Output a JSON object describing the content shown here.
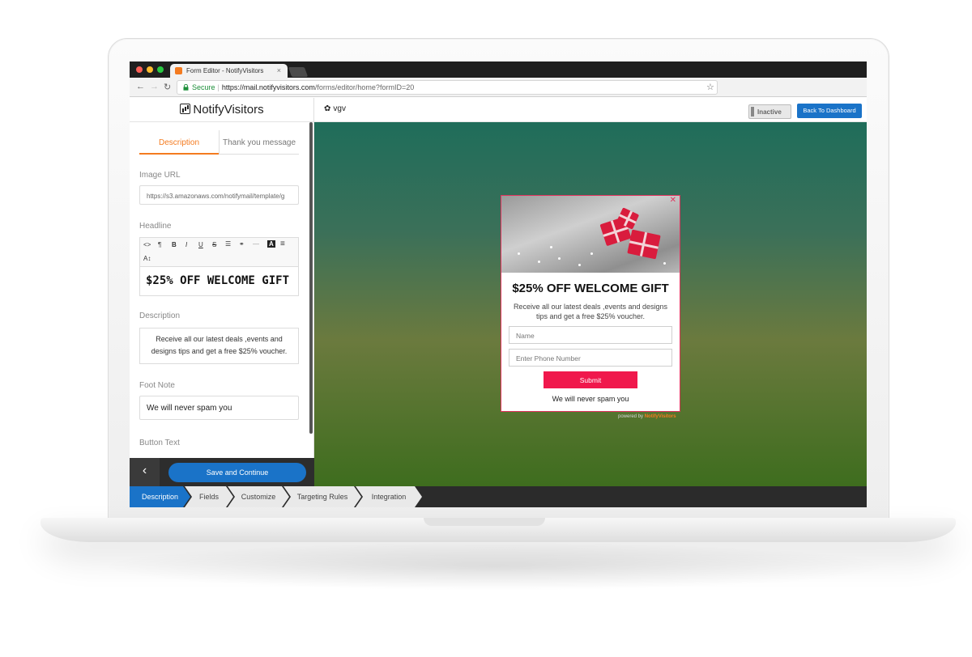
{
  "browser": {
    "tab_title": "Form Editor - NotifyVisitors",
    "secure_label": "Secure",
    "url_host": "https://mail.notifyvisitors.com",
    "url_path": "/forms/editor/home?formID=20"
  },
  "sidebar": {
    "logo_text": "NotifyVisitors",
    "tabs": [
      {
        "label": "Description"
      },
      {
        "label": "Thank you message"
      }
    ],
    "image_url_label": "Image URL",
    "image_url_value": "https://s3.amazonaws.com/notifymail/template/g",
    "headline_label": "Headline",
    "headline_value": "$25% OFF WELCOME GIFT",
    "description_label": "Description",
    "description_value": "Receive all our latest deals ,events and designs tips and get a free $25% voucher.",
    "footnote_label": "Foot Note",
    "footnote_value": "We will never spam you",
    "button_text_label": "Button Text",
    "save_label": "Save and Continue",
    "back_icon": "‹"
  },
  "editor_toolbar": {
    "code": "<>",
    "paragraph": "¶",
    "bold": "B",
    "italic": "I",
    "underline": "U",
    "strike": "S",
    "list": "☰",
    "link": "⚭",
    "rule": "—",
    "color": "A",
    "align": "≡",
    "font_size": "A↕"
  },
  "topbar": {
    "form_name": "vgv",
    "status": "Inactive",
    "dashboard_label": "Back To Dashboard"
  },
  "popup": {
    "title": "$25% OFF WELCOME GIFT",
    "description": "Receive all our latest deals ,events and designs tips and get a free $25% voucher.",
    "name_placeholder": "Name",
    "phone_placeholder": "Enter Phone Number",
    "submit_label": "Submit",
    "footnote": "We will never spam you",
    "powered_by": "powered by",
    "powered_brand": "NotifyVisitors",
    "close_icon": "✕"
  },
  "steps": [
    {
      "label": "Description",
      "active": true
    },
    {
      "label": "Fields",
      "active": false
    },
    {
      "label": "Customize",
      "active": false
    },
    {
      "label": "Targeting Rules",
      "active": false
    },
    {
      "label": "Integration",
      "active": false
    }
  ],
  "colors": {
    "accent_blue": "#1a73c8",
    "accent_orange": "#f47b20",
    "popup_red": "#f0184c"
  }
}
